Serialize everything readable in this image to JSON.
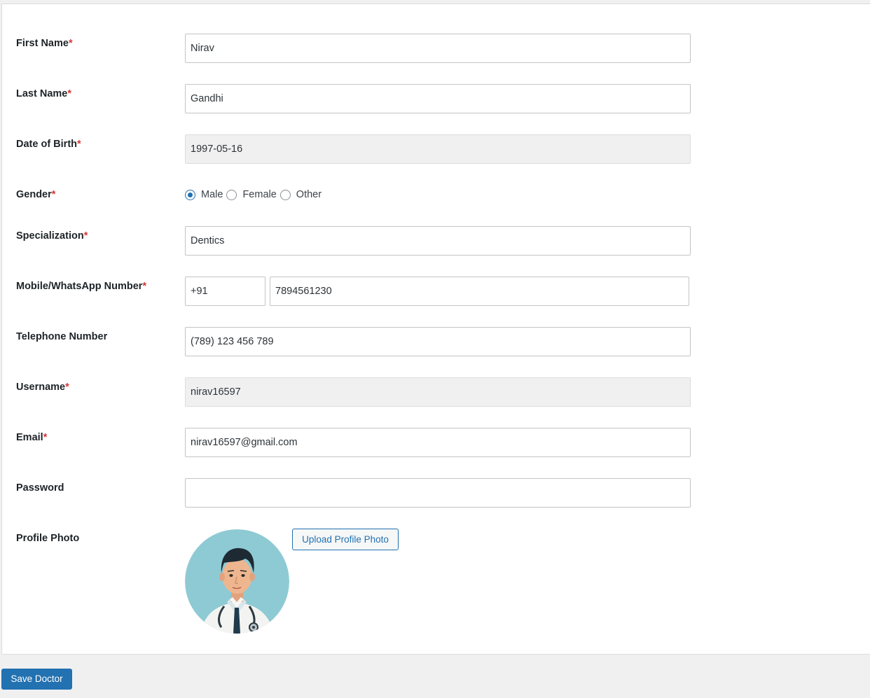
{
  "form": {
    "first_name": {
      "label": "First Name",
      "required": "*",
      "value": "Nirav"
    },
    "last_name": {
      "label": "Last Name",
      "required": "*",
      "value": "Gandhi"
    },
    "dob": {
      "label": "Date of Birth",
      "required": "*",
      "value": "1997-05-16"
    },
    "gender": {
      "label": "Gender",
      "required": "*",
      "options": [
        "Male",
        "Female",
        "Other"
      ],
      "selected": "Male"
    },
    "specialization": {
      "label": "Specialization",
      "required": "*",
      "value": "Dentics"
    },
    "mobile": {
      "label": "Mobile/WhatsApp Number",
      "required": "*",
      "country_code": "+91",
      "value": "7894561230"
    },
    "telephone": {
      "label": "Telephone Number",
      "value": "(789) 123 456 789"
    },
    "username": {
      "label": "Username",
      "required": "*",
      "value": "nirav16597"
    },
    "email": {
      "label": "Email",
      "required": "*",
      "value": "nirav16597@gmail.com"
    },
    "password": {
      "label": "Password",
      "value": ""
    },
    "profile_photo": {
      "label": "Profile Photo",
      "upload_label": "Upload Profile Photo"
    }
  },
  "save_label": "Save Doctor",
  "colors": {
    "accent": "#2271b1",
    "required": "#d63638",
    "avatar_bg": "#8ecad4"
  }
}
